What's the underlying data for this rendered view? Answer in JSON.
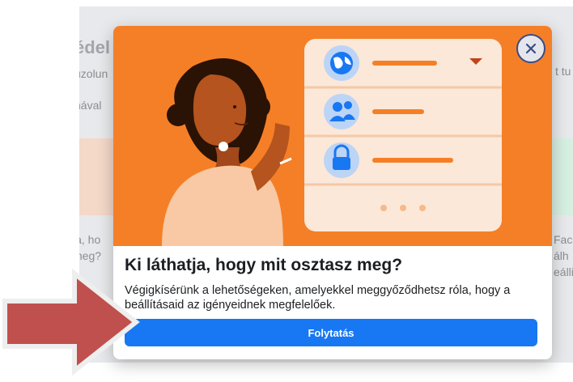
{
  "background": {
    "title_fragment": "édel",
    "line1": "uzolun",
    "line2": "nával",
    "right_fragment": "t tu",
    "left_caption_1": "ja, ho",
    "left_caption_2": "meg?",
    "right_caption_1": "Fac",
    "right_caption_2": "álh",
    "right_caption_3": "eálli"
  },
  "modal": {
    "heading": "Ki láthatja, hogy mit osztasz meg?",
    "description": "Végigkísérünk a lehetőségeken, amelyekkel meggyőződhetsz róla, hogy a beállításaid az igényeidnek megfelelőek.",
    "continue_label": "Folytatás",
    "close_icon": "close-icon"
  },
  "illustration": {
    "rows": [
      {
        "icon": "globe-icon"
      },
      {
        "icon": "friends-icon"
      },
      {
        "icon": "lock-icon"
      }
    ],
    "colors": {
      "hero_bg": "#f57f27",
      "accent": "#1877f2",
      "arrow": "#c0504d"
    }
  }
}
